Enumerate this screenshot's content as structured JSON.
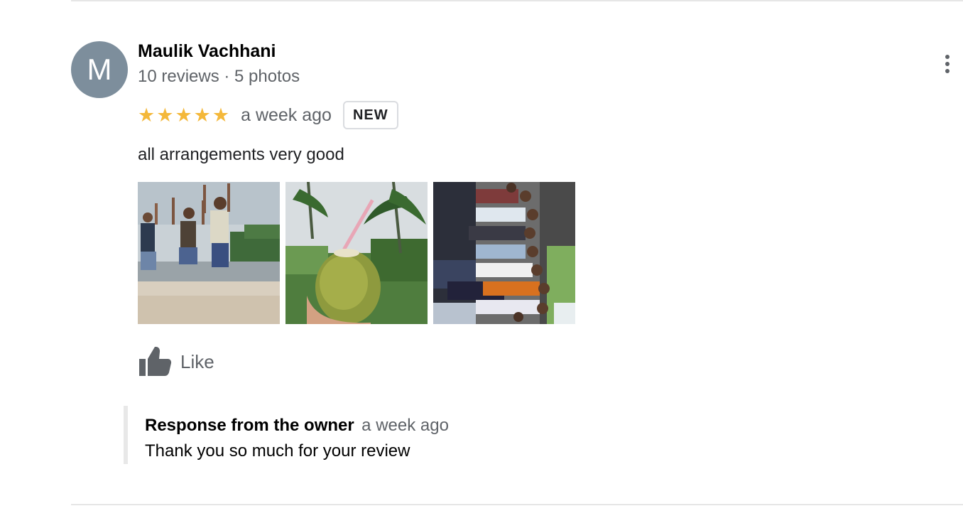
{
  "reviewer": {
    "initial": "M",
    "name": "Maulik Vachhani",
    "meta": "10 reviews · 5 photos"
  },
  "rating": {
    "stars": 5,
    "max_stars": 5,
    "star_glyph": "★",
    "star_color": "#f4b83a",
    "date": "a week ago",
    "badge": "NEW"
  },
  "review": {
    "text": "all arrangements very good"
  },
  "photos": [
    {
      "icon": "beach-jump-photo"
    },
    {
      "icon": "coconut-photo"
    },
    {
      "icon": "group-photo"
    }
  ],
  "actions": {
    "like_label": "Like",
    "more_icon": "more-vert-icon",
    "like_icon": "thumb-up-icon"
  },
  "owner_response": {
    "title": "Response from the owner",
    "date": "a week ago",
    "text": "Thank you so much for your review"
  },
  "colors": {
    "avatar_bg": "#7d8e9c",
    "secondary_text": "#5f6368",
    "divider": "#e6e6e6"
  }
}
